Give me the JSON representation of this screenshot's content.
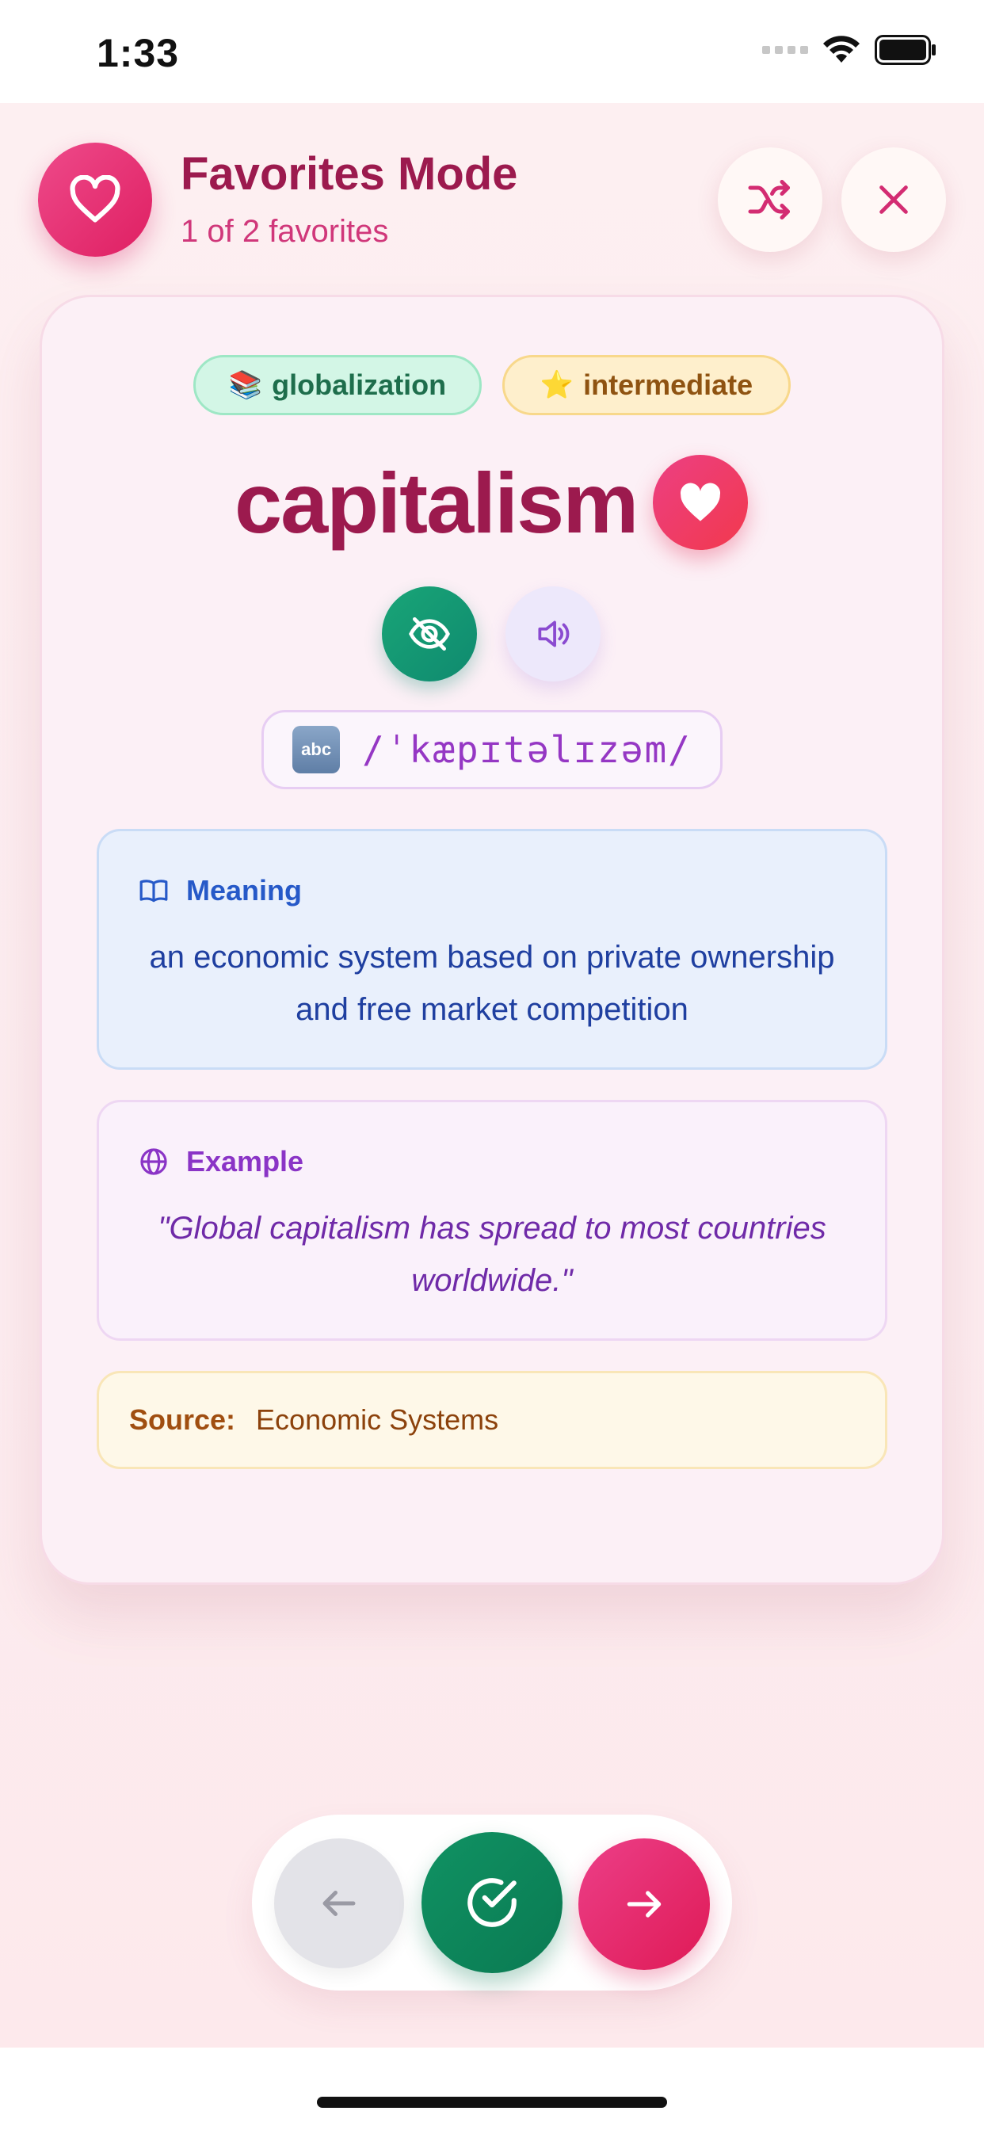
{
  "status_bar": {
    "time": "1:33",
    "icons": [
      "signal-icon",
      "wifi-icon",
      "battery-icon"
    ]
  },
  "header": {
    "title": "Favorites Mode",
    "subtitle": "1 of 2 favorites",
    "icons": [
      "heart-icon",
      "shuffle-icon",
      "close-icon"
    ],
    "accent_color": "#df1f62"
  },
  "card": {
    "tags": {
      "topic": {
        "emoji": "📚",
        "label": "globalization"
      },
      "level": {
        "emoji": "⭐",
        "label": "intermediate"
      }
    },
    "word": "capitalism",
    "is_favorite": true,
    "phonetic": {
      "icon_text": "abc",
      "text": "/ˈkæpɪtəlɪzəm/"
    },
    "meaning": {
      "heading": "Meaning",
      "text": "an economic system based on private ownership and free market competition"
    },
    "example": {
      "heading": "Example",
      "text": "\"Global capitalism has spread to most countries worldwide.\""
    },
    "source": {
      "label": "Source:",
      "value": "Economic Systems"
    }
  },
  "bottom_nav": {
    "buttons": [
      "arrow-left-icon",
      "check-circle-icon",
      "arrow-right-icon"
    ]
  }
}
